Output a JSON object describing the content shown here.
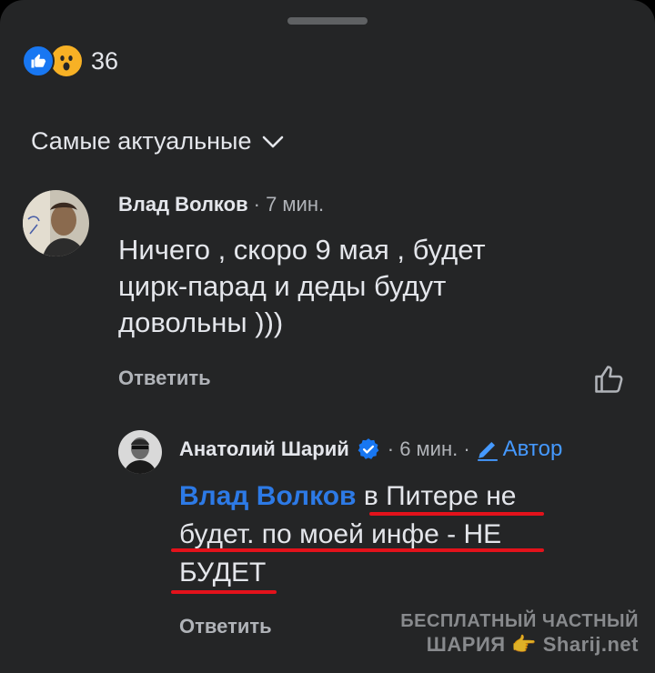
{
  "reactions": {
    "count": "36",
    "types": [
      "like-icon",
      "wow-icon"
    ]
  },
  "sort": {
    "label": "Самые актуальные"
  },
  "comments": [
    {
      "author": "Влад Волков",
      "time": "· 7 мин.",
      "text": "Ничего  , скоро 9 мая , будет цирк-парад и деды будут довольны )))",
      "reply_label": "Ответить"
    }
  ],
  "reply": {
    "author": "Анатолий Шарий",
    "time": "· 6 мин. ·",
    "author_badge": "Автор",
    "mention": "Влад Волков",
    "text_parts": [
      "в Питере не",
      "будет. по моей инфе - НЕ",
      "БУДЕТ"
    ],
    "reply_label": "Ответить"
  },
  "watermark": {
    "line1": "БЕСПЛАТНЫЙ ЧАСТНЫЙ",
    "line2": "ШАРИЯ",
    "line2_site": "Sharij.net"
  },
  "colors": {
    "background": "#242526",
    "accent": "#1877f2",
    "mention": "#2d7ae6",
    "highlight": "#e3121b"
  }
}
